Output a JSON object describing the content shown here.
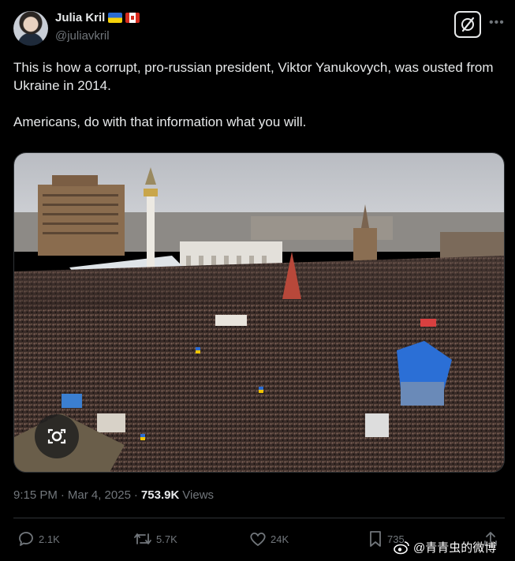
{
  "author": {
    "display_name": "Julia Kril",
    "handle": "@juliavkril",
    "flags": [
      "ukraine-flag-icon",
      "canada-flag-icon"
    ]
  },
  "tweet": {
    "paragraph_1": "This is how a corrupt, pro-russian president, Viktor Yanukovych, was ousted from Ukraine in 2014.",
    "paragraph_2": "Americans, do with that information what you will."
  },
  "meta": {
    "time": "9:15 PM",
    "separator": "·",
    "date": "Mar 4, 2025",
    "views_count": "753.9K",
    "views_label": "Views"
  },
  "actions": {
    "replies": "2.1K",
    "reposts": "5.7K",
    "likes": "24K",
    "bookmarks": "735"
  },
  "watermark": {
    "text": "@青青虫的微博"
  },
  "colors": {
    "background": "#000000",
    "text": "#e7e9ea",
    "muted": "#71767b",
    "border": "#2f3336"
  }
}
